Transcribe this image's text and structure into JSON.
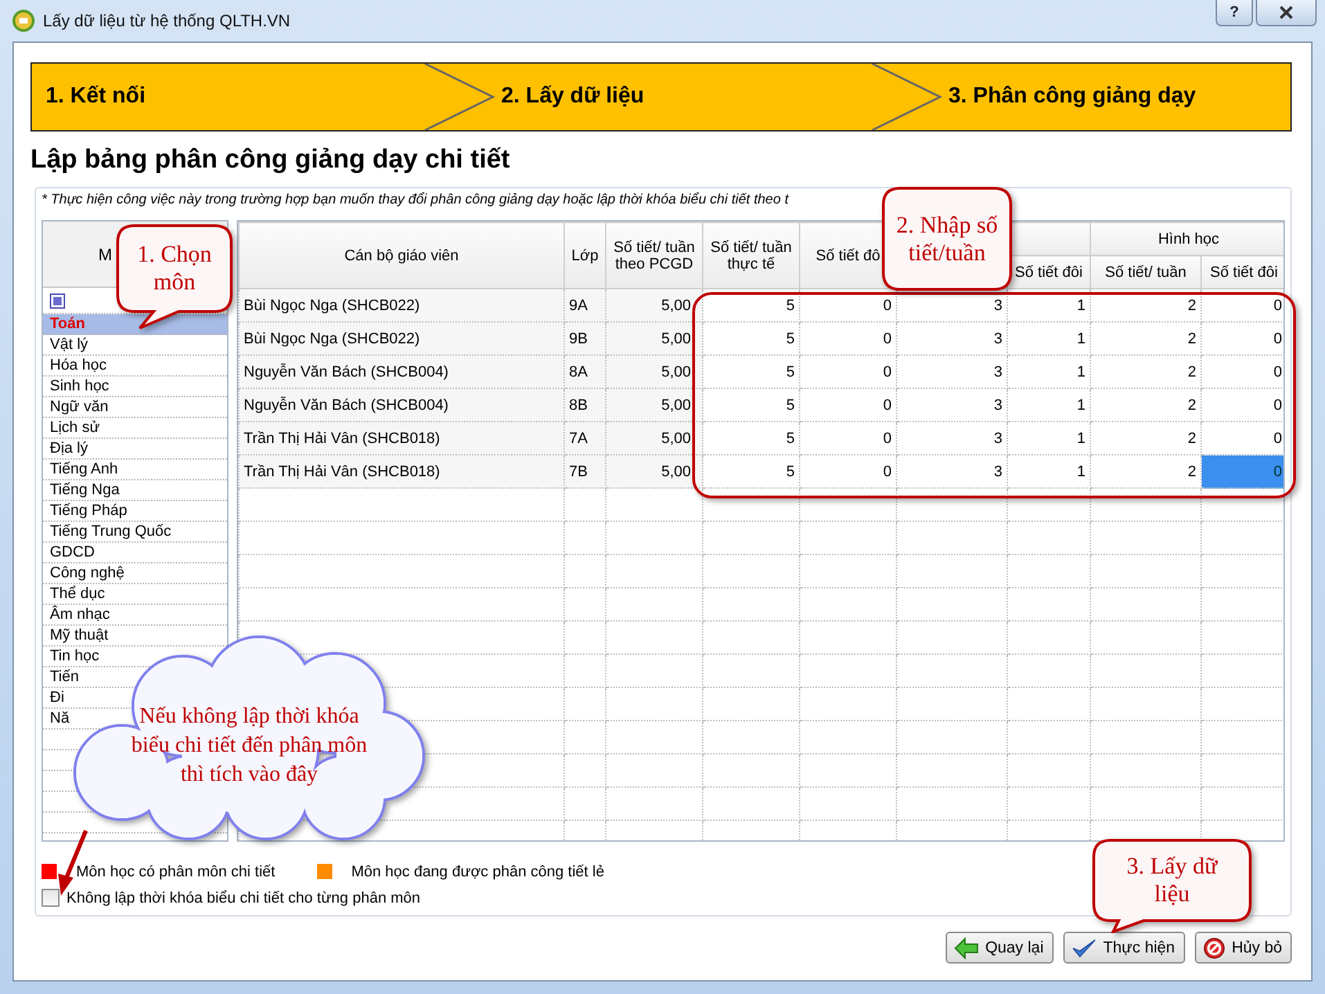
{
  "window": {
    "title": "Lấy dữ liệu từ hệ thống QLTH.VN",
    "help_button": "?"
  },
  "steps": [
    {
      "label": "1. Kết nối"
    },
    {
      "label": "2. Lấy dữ liệu"
    },
    {
      "label": "3. Phân công giảng dạy"
    }
  ],
  "heading": "Lập bảng phân công giảng dạy chi tiết",
  "note": "* Thực hiện công việc này trong trường hợp bạn muốn thay đổi phân công giảng dạy hoặc lập thời khóa biểu chi tiết theo t",
  "subjects": {
    "header": "M",
    "items": [
      {
        "label": "Toán",
        "selected": true
      },
      {
        "label": "Vật lý",
        "selected": false
      },
      {
        "label": "Hóa học",
        "selected": false
      },
      {
        "label": "Sinh học",
        "selected": false
      },
      {
        "label": "Ngữ văn",
        "selected": false
      },
      {
        "label": "Lịch sử",
        "selected": false
      },
      {
        "label": "Địa lý",
        "selected": false
      },
      {
        "label": "Tiếng Anh",
        "selected": false
      },
      {
        "label": "Tiếng Nga",
        "selected": false
      },
      {
        "label": "Tiếng Pháp",
        "selected": false
      },
      {
        "label": "Tiếng Trung Quốc",
        "selected": false
      },
      {
        "label": "GDCD",
        "selected": false
      },
      {
        "label": "Công nghệ",
        "selected": false
      },
      {
        "label": "Thể dục",
        "selected": false
      },
      {
        "label": "Âm nhạc",
        "selected": false
      },
      {
        "label": "Mỹ thuật",
        "selected": false
      },
      {
        "label": "Tin học",
        "selected": false
      },
      {
        "label": "Tiến",
        "selected": false
      },
      {
        "label": "Đi",
        "selected": false
      },
      {
        "label": "Nă",
        "selected": false
      }
    ]
  },
  "table": {
    "columns": [
      {
        "label": "Cán bộ giáo viên"
      },
      {
        "label": "Lớp"
      },
      {
        "label": "Số tiết/ tuần theo PCGD"
      },
      {
        "label": "Số tiết/ tuần thực tế"
      },
      {
        "label": "Số tiết đô"
      }
    ],
    "groups": [
      {
        "columns": [
          {
            "kind": "blank"
          },
          {
            "kind": "text",
            "label": "Số tiết đôi"
          }
        ]
      },
      {
        "label": "Hình học",
        "columns": [
          {
            "kind": "text",
            "label": "Số tiết/ tuần"
          },
          {
            "kind": "text",
            "label": "Số tiết đôi"
          }
        ]
      }
    ],
    "rows": [
      {
        "cells": [
          {
            "text": "Bùi Ngọc Nga (SHCB022)",
            "selected": false
          },
          {
            "text": "9A",
            "selected": false
          },
          {
            "text": "5,00",
            "selected": false
          },
          {
            "text": "5",
            "selected": false
          },
          {
            "text": "0",
            "selected": false
          },
          {
            "text": "3",
            "selected": false
          },
          {
            "text": "1",
            "selected": false
          },
          {
            "text": "2",
            "selected": false
          },
          {
            "text": "0",
            "selected": false
          }
        ]
      },
      {
        "cells": [
          {
            "text": "Bùi Ngọc Nga (SHCB022)",
            "selected": false
          },
          {
            "text": "9B",
            "selected": false
          },
          {
            "text": "5,00",
            "selected": false
          },
          {
            "text": "5",
            "selected": false
          },
          {
            "text": "0",
            "selected": false
          },
          {
            "text": "3",
            "selected": false
          },
          {
            "text": "1",
            "selected": false
          },
          {
            "text": "2",
            "selected": false
          },
          {
            "text": "0",
            "selected": false
          }
        ]
      },
      {
        "cells": [
          {
            "text": "Nguyễn Văn  Bách (SHCB004)",
            "selected": false
          },
          {
            "text": "8A",
            "selected": false
          },
          {
            "text": "5,00",
            "selected": false
          },
          {
            "text": "5",
            "selected": false
          },
          {
            "text": "0",
            "selected": false
          },
          {
            "text": "3",
            "selected": false
          },
          {
            "text": "1",
            "selected": false
          },
          {
            "text": "2",
            "selected": false
          },
          {
            "text": "0",
            "selected": false
          }
        ]
      },
      {
        "cells": [
          {
            "text": "Nguyễn Văn  Bách (SHCB004)",
            "selected": false
          },
          {
            "text": "8B",
            "selected": false
          },
          {
            "text": "5,00",
            "selected": false
          },
          {
            "text": "5",
            "selected": false
          },
          {
            "text": "0",
            "selected": false
          },
          {
            "text": "3",
            "selected": false
          },
          {
            "text": "1",
            "selected": false
          },
          {
            "text": "2",
            "selected": false
          },
          {
            "text": "0",
            "selected": false
          }
        ]
      },
      {
        "cells": [
          {
            "text": "Trần Thị Hải Vân (SHCB018)",
            "selected": false
          },
          {
            "text": "7A",
            "selected": false
          },
          {
            "text": "5,00",
            "selected": false
          },
          {
            "text": "5",
            "selected": false
          },
          {
            "text": "0",
            "selected": false
          },
          {
            "text": "3",
            "selected": false
          },
          {
            "text": "1",
            "selected": false
          },
          {
            "text": "2",
            "selected": false
          },
          {
            "text": "0",
            "selected": false
          }
        ]
      },
      {
        "cells": [
          {
            "text": "Trần Thị Hải Vân (SHCB018)",
            "selected": false
          },
          {
            "text": "7B",
            "selected": false
          },
          {
            "text": "5,00",
            "selected": false
          },
          {
            "text": "5",
            "selected": false
          },
          {
            "text": "0",
            "selected": false
          },
          {
            "text": "3",
            "selected": false
          },
          {
            "text": "1",
            "selected": false
          },
          {
            "text": "2",
            "selected": false
          },
          {
            "text": "0",
            "selected": true
          }
        ]
      }
    ]
  },
  "legend": [
    {
      "color": "#ff0000",
      "label": "Môn học có phân môn chi tiết"
    },
    {
      "color": "#ff8c00",
      "label": "Môn học đang được phân công tiết lẻ"
    }
  ],
  "option": {
    "label": "Không lập thời khóa biểu chi tiết cho từng phân môn",
    "checked": false
  },
  "buttons": [
    {
      "kind": "back",
      "label": "Quay lại"
    },
    {
      "kind": "ok",
      "label": "Thực hiện"
    },
    {
      "kind": "cancel",
      "label": "Hủy bỏ"
    }
  ],
  "callouts": [
    {
      "kind": "bubble",
      "text": "1. Chọn môn"
    },
    {
      "kind": "bubble",
      "text": "2. Nhập số tiết/tuần"
    },
    {
      "kind": "cloud",
      "text": "Nếu không lập thời khóa biểu chi tiết đến phân môn thì tích vào đây"
    },
    {
      "kind": "bubble",
      "text": "3. Lấy dữ liệu"
    }
  ]
}
